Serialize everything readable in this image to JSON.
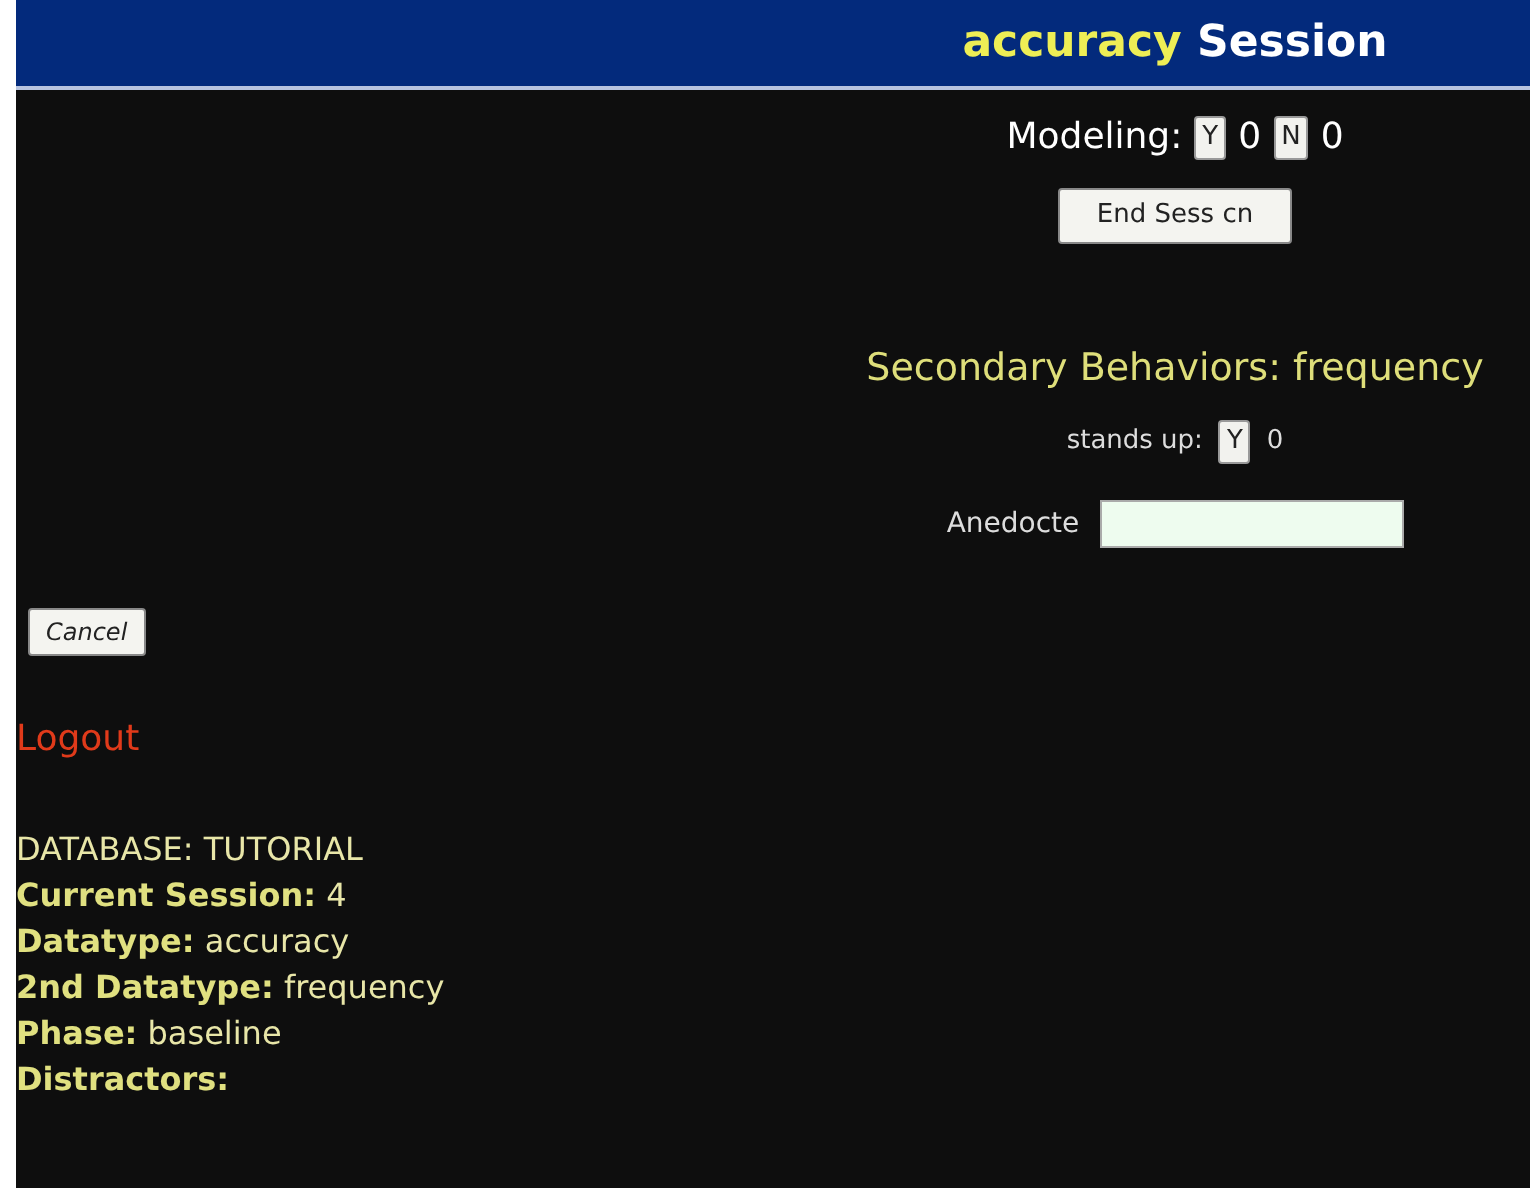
{
  "header": {
    "datatype": "accuracy",
    "title": "Session"
  },
  "modeling": {
    "label": "Modeling:",
    "buttons": [
      {
        "label": "Y",
        "count": "0"
      },
      {
        "label": "N",
        "count": "0"
      }
    ]
  },
  "end_button": "End Sess cn",
  "secondary": {
    "title": "Secondary Behaviors: frequency",
    "behaviors": [
      {
        "label": "stands up:",
        "button": "Y",
        "count": "0"
      }
    ],
    "anecdote_label": "Anedocte"
  },
  "cancel_button": "Cancel",
  "logout": "Logout",
  "info": [
    "DATABASE: TUTORIAL",
    "**Current Session:** 4",
    "**Datatype:** accuracy",
    "**2nd Datatype:** frequency",
    "**Phase:** baseline",
    "**Distractors:**"
  ]
}
